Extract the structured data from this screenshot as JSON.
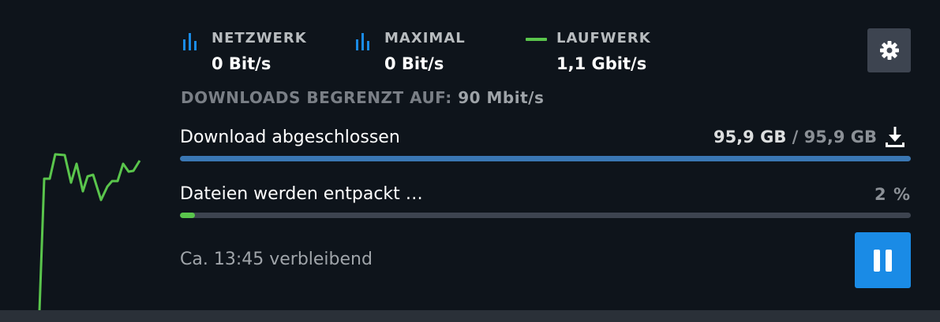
{
  "stats": {
    "network": {
      "label": "NETZWERK",
      "value": "0 Bit/s",
      "icon": "bar-chart-icon"
    },
    "peak": {
      "label": "MAXIMAL",
      "value": "0 Bit/s",
      "icon": "bar-chart-icon"
    },
    "disk": {
      "label": "LAUFWERK",
      "value": "1,1 Gbit/s",
      "icon": "green-line-icon"
    }
  },
  "limit": {
    "label": "DOWNLOADS BEGRENZT AUF:",
    "value": "90 Mbit/s"
  },
  "download": {
    "title": "Download abgeschlossen",
    "done": "95,9 GB",
    "separator": "/",
    "total": "95,9 GB",
    "progress": 1.0
  },
  "unpack": {
    "title": "Dateien werden entpackt …",
    "percent_label": "2 %",
    "progress": 0.02
  },
  "remaining": "Ca. 13:45 verbleibend",
  "colors": {
    "accent_blue": "#1a8be6",
    "download_bar": "#3a77b4",
    "disk_green": "#5ac54c",
    "background": "#0e141b"
  }
}
